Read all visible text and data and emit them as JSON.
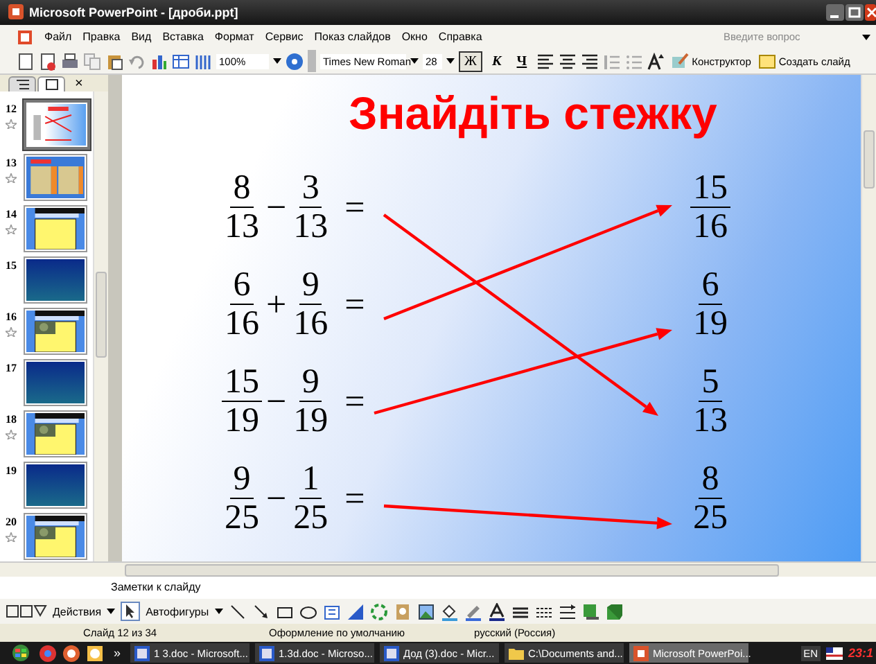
{
  "window": {
    "title": "Microsoft PowerPoint - [дроби.ppt]"
  },
  "menu": [
    "Файл",
    "Правка",
    "Вид",
    "Вставка",
    "Формат",
    "Сервис",
    "Показ слайдов",
    "Окно",
    "Справка"
  ],
  "help_field": {
    "placeholder": "Введите вопрос"
  },
  "toolbar": {
    "zoom": "100%",
    "font": "Times New Roman",
    "size": "28",
    "format_buttons": [
      {
        "label": "Ж",
        "selected": true
      },
      {
        "label": "К",
        "selected": false
      },
      {
        "label": "Ч",
        "selected": false
      }
    ],
    "designer": "Конструктор",
    "new_slide": "Создать слайд"
  },
  "pane_tabs": [
    {
      "kind": "outline",
      "selected": false
    },
    {
      "kind": "slides",
      "selected": true
    }
  ],
  "pane_close": "×",
  "thumbnails": [
    {
      "number": "12",
      "kind": "fractions",
      "selected": true
    },
    {
      "number": "13",
      "kind": "table",
      "selected": false
    },
    {
      "number": "14",
      "kind": "yellow",
      "selected": false
    },
    {
      "number": "15",
      "kind": "blue",
      "selected": false
    },
    {
      "number": "16",
      "kind": "yellow-photo",
      "selected": false
    },
    {
      "number": "17",
      "kind": "blue",
      "selected": false
    },
    {
      "number": "18",
      "kind": "yellow-photo",
      "selected": false
    },
    {
      "number": "19",
      "kind": "blue",
      "selected": false
    },
    {
      "number": "20",
      "kind": "yellow-photo",
      "selected": false
    }
  ],
  "slide": {
    "title": "Знайдіть стежку",
    "expressions": [
      {
        "a": {
          "num": "8",
          "den": "13"
        },
        "op": "−",
        "b": {
          "num": "3",
          "den": "13"
        },
        "eq": "="
      },
      {
        "a": {
          "num": "6",
          "den": "16"
        },
        "op": "+",
        "b": {
          "num": "9",
          "den": "16"
        },
        "eq": "="
      },
      {
        "a": {
          "num": "15",
          "den": "19"
        },
        "op": "−",
        "b": {
          "num": "9",
          "den": "19"
        },
        "eq": "="
      },
      {
        "a": {
          "num": "9",
          "den": "25"
        },
        "op": "−",
        "b": {
          "num": "1",
          "den": "25"
        },
        "eq": "="
      }
    ],
    "answers": [
      {
        "num": "15",
        "den": "16"
      },
      {
        "num": "6",
        "den": "19"
      },
      {
        "num": "5",
        "den": "13"
      },
      {
        "num": "8",
        "den": "25"
      }
    ]
  },
  "notes": "Заметки к слайду",
  "draw_toolbar": {
    "actions": "Действия",
    "autoshapes": "Автофигуры"
  },
  "status_bar": [
    "Слайд 12 из 34",
    "Оформление по умолчанию",
    "русский (Россия)"
  ],
  "taskbar": {
    "more": "»",
    "tasks": [
      {
        "label": "1 3.doc - Microsoft...",
        "kind": "word",
        "selected": false
      },
      {
        "label": "1.3d.doc - Microso...",
        "kind": "word",
        "selected": false
      },
      {
        "label": "Дод (3).doc - Micr...",
        "kind": "word",
        "selected": false
      },
      {
        "label": "C:\\Documents and...",
        "kind": "folder",
        "selected": false
      },
      {
        "label": "Microsoft PowerPoi...",
        "kind": "powerpoint",
        "selected": true
      }
    ],
    "language": "EN",
    "clock": "23:1"
  }
}
